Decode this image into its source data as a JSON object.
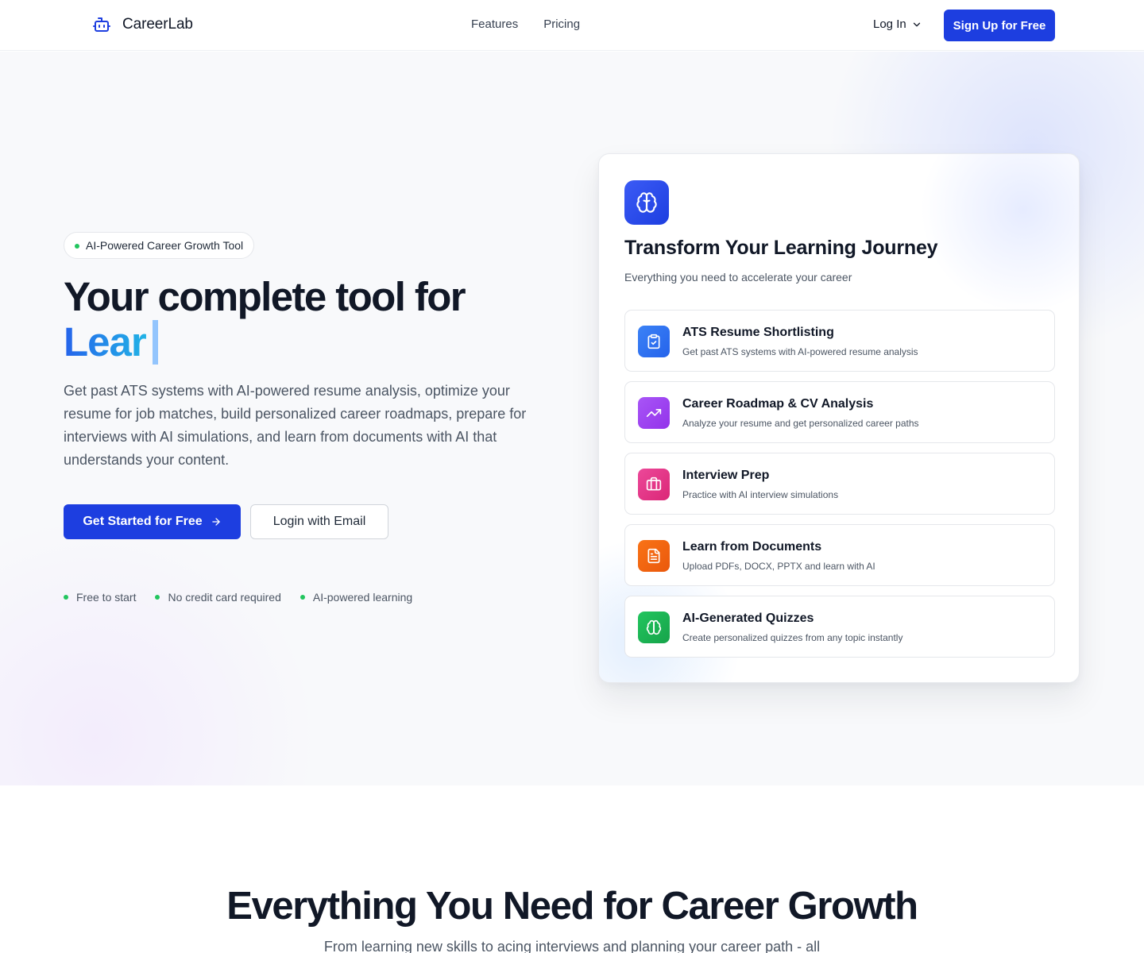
{
  "nav": {
    "brand": "CareerLab",
    "links": [
      "Features",
      "Pricing"
    ],
    "login_label": "Log In",
    "signup_label": "Sign Up for Free"
  },
  "hero": {
    "badge": "AI-Powered Career Growth Tool",
    "headline": "Your complete tool for",
    "typed_word": "Lear",
    "description": "Get past ATS systems with AI-powered resume analysis, optimize your resume for job matches, build personalized career roadmaps, prepare for interviews with AI simulations, and learn from documents with AI that understands your content.",
    "primary_cta": "Get Started for Free",
    "secondary_cta": "Login with Email",
    "checks": [
      "Free to start",
      "No credit card required",
      "AI-powered learning"
    ]
  },
  "card": {
    "icon": "brain-icon",
    "title": "Transform Your Learning Journey",
    "subtitle": "Everything you need to accelerate your career",
    "features": [
      {
        "title": "ATS Resume Shortlisting",
        "description": "Get past ATS systems with AI-powered resume analysis",
        "icon": "clipboard-check-icon",
        "color": "#3b82f6"
      },
      {
        "title": "Career Roadmap & CV Analysis",
        "description": "Analyze your resume and get personalized career paths",
        "icon": "trending-up-icon",
        "color": "#a855f7"
      },
      {
        "title": "Interview Prep",
        "description": "Practice with AI interview simulations",
        "icon": "briefcase-icon",
        "color": "#ec4899"
      },
      {
        "title": "Learn from Documents",
        "description": "Upload PDFs, DOCX, PPTX and learn with AI",
        "icon": "file-text-icon",
        "color": "#f97316"
      },
      {
        "title": "AI-Generated Quizzes",
        "description": "Create personalized quizzes from any topic instantly",
        "icon": "brain-icon",
        "color": "#22c55e"
      }
    ]
  },
  "section2": {
    "title": "Everything You Need for Career Growth",
    "subtitle": "From learning new skills to acing interviews and planning your career path - all"
  },
  "colors": {
    "primary": "#1d3ee0",
    "success_dot": "#22c55e",
    "text_dark": "#111827",
    "text_muted": "#4b5563"
  }
}
